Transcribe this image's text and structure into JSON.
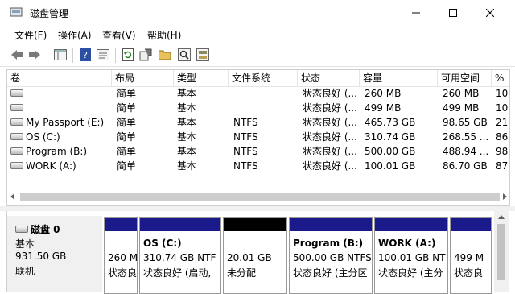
{
  "window": {
    "title": "磁盘管理"
  },
  "menu": [
    "文件(F)",
    "操作(A)",
    "查看(V)",
    "帮助(H)"
  ],
  "columns": [
    "卷",
    "布局",
    "类型",
    "文件系统",
    "状态",
    "容量",
    "可用空间",
    "%"
  ],
  "volumes": [
    {
      "name": "",
      "layout": "简单",
      "type": "基本",
      "fs": "",
      "status": "状态良好 (...",
      "capacity": "260 MB",
      "free": "260 MB",
      "pct": "10"
    },
    {
      "name": "",
      "layout": "简单",
      "type": "基本",
      "fs": "",
      "status": "状态良好 (...",
      "capacity": "499 MB",
      "free": "499 MB",
      "pct": "10"
    },
    {
      "name": "My Passport (E:)",
      "layout": "简单",
      "type": "基本",
      "fs": "NTFS",
      "status": "状态良好 (...",
      "capacity": "465.73 GB",
      "free": "98.65 GB",
      "pct": "21"
    },
    {
      "name": "OS (C:)",
      "layout": "简单",
      "type": "基本",
      "fs": "NTFS",
      "status": "状态良好 (...",
      "capacity": "310.74 GB",
      "free": "268.55 ...",
      "pct": "86"
    },
    {
      "name": "Program (B:)",
      "layout": "简单",
      "type": "基本",
      "fs": "NTFS",
      "status": "状态良好 (...",
      "capacity": "500.00 GB",
      "free": "488.94 ...",
      "pct": "98"
    },
    {
      "name": "WORK (A:)",
      "layout": "简单",
      "type": "基本",
      "fs": "NTFS",
      "status": "状态良好 (...",
      "capacity": "100.01 GB",
      "free": "86.70 GB",
      "pct": "87"
    }
  ],
  "disk": {
    "name": "磁盘 0",
    "type": "基本",
    "size": "931.50 GB",
    "status": "联机"
  },
  "partitions": [
    {
      "title": "",
      "line1": "260 M",
      "line2": "状态良"
    },
    {
      "title": "OS  (C:)",
      "line1": "310.74 GB NTF",
      "line2": "状态良好 (启动,"
    },
    {
      "title": "",
      "line1": "20.01 GB",
      "line2": "未分配"
    },
    {
      "title": "Program  (B:)",
      "line1": "500.00 GB NTFS",
      "line2": "状态良好 (主分区"
    },
    {
      "title": "WORK  (A:)",
      "line1": "100.01 GB NT",
      "line2": "状态良好 (主分"
    },
    {
      "title": "",
      "line1": "499 M",
      "line2": "状态良"
    }
  ],
  "icons": [
    "back-icon",
    "forward-icon",
    "console-tree-icon",
    "help-icon",
    "properties-icon",
    "refresh-icon",
    "settings-icon",
    "open-folder-icon",
    "search-icon",
    "disk-check-icon"
  ],
  "colors": {
    "primary_partition": "#1a1a8a",
    "unallocated": "#000000"
  }
}
